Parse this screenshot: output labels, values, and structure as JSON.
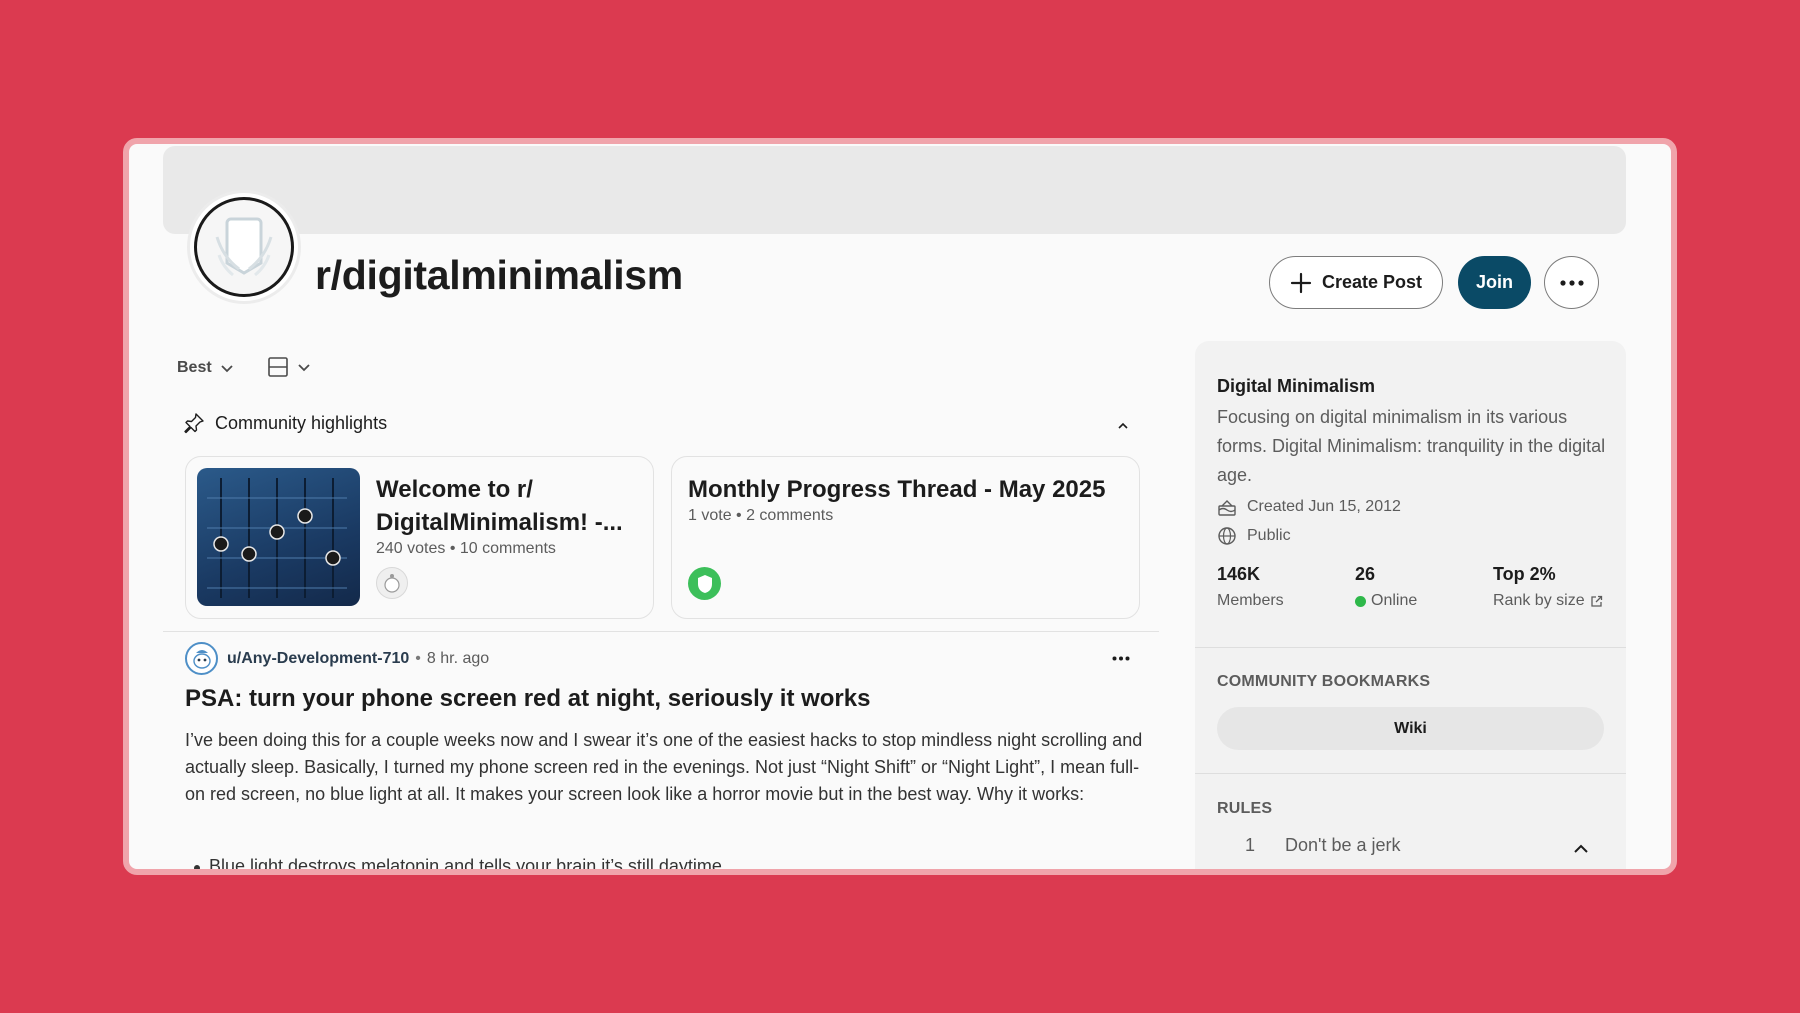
{
  "header": {
    "subreddit_name": "r/digitalminimalism",
    "create_post_label": "Create Post",
    "join_label": "Join"
  },
  "feed_controls": {
    "sort_label": "Best"
  },
  "highlights": {
    "heading": "Community highlights",
    "cards": [
      {
        "title": "Welcome to r/ DigitalMinimalism! -...",
        "meta": "240 votes • 10 comments"
      },
      {
        "title": "Monthly Progress Thread - May 2025",
        "meta": "1 vote • 2 comments"
      }
    ]
  },
  "post": {
    "author": "u/Any-Development-710",
    "separator": "•",
    "time": "8 hr. ago",
    "title": "PSA: turn your phone screen red at night, seriously it works",
    "body": "I’ve been doing this for a couple weeks now and I swear it’s one of the easiest hacks to stop mindless night scrolling and actually sleep. Basically, I turned my phone screen red in the evenings. Not just “Night Shift” or “Night Light”, I mean full-on red screen, no blue light at all. It makes your screen look like a horror movie but in the best way. Why it works:",
    "bullet": "Blue light destroys melatonin and tells your brain it’s still daytime"
  },
  "sidebar": {
    "name": "Digital Minimalism",
    "description": "Focusing on digital minimalism in its various forms. Digital Minimalism: tranquility in the digital age.",
    "created": "Created Jun 15, 2012",
    "visibility": "Public",
    "stats": {
      "members_value": "146K",
      "members_label": "Members",
      "online_value": "26",
      "online_label": "Online",
      "rank_value": "Top 2%",
      "rank_label": "Rank by size"
    },
    "bookmarks_heading": "COMMUNITY BOOKMARKS",
    "wiki_label": "Wiki",
    "rules_heading": "RULES",
    "rules": [
      {
        "number": "1",
        "text": "Don't be a jerk"
      }
    ]
  },
  "colors": {
    "background": "#db3a50",
    "join_button": "#0a4a66",
    "online_indicator": "#2eb84a"
  }
}
